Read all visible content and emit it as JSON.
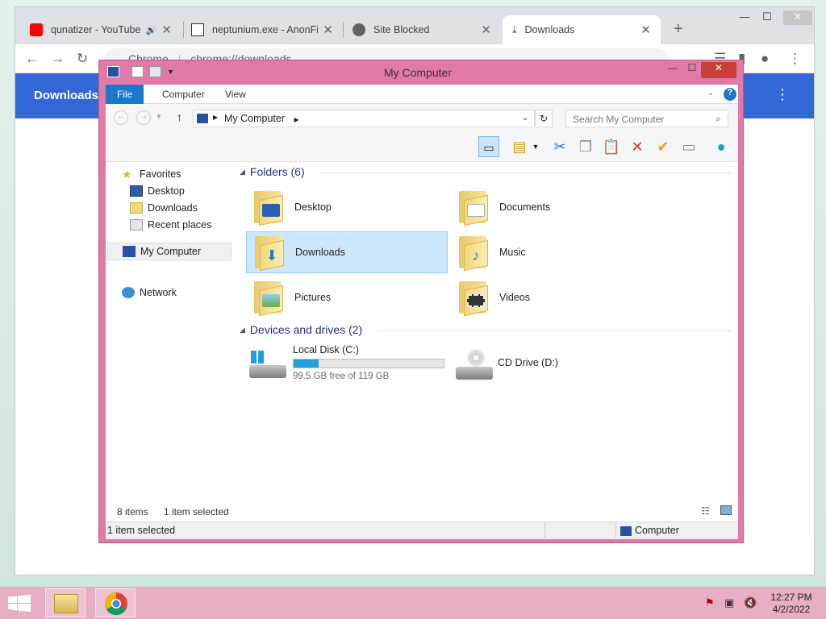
{
  "browser": {
    "tabs": [
      {
        "title": "qunatizer - YouTube",
        "favicon": "youtube-icon",
        "audio": true
      },
      {
        "title": "neptunium.exe - AnonFile",
        "favicon": "anonfiles-icon"
      },
      {
        "title": "Site Blocked",
        "favicon": "globe-icon"
      },
      {
        "title": "Downloads",
        "favicon": "download-icon",
        "active": true
      }
    ],
    "new_tab": "+",
    "omnibox_host": "Chrome",
    "omnibox_url": "chrome://downloads",
    "page_header": "Downloads",
    "colors": {
      "header": "#3367d6",
      "tabstrip": "#dee1e6"
    }
  },
  "explorer": {
    "title": "My Computer",
    "ribbon_tabs": [
      "File",
      "Computer",
      "View"
    ],
    "address": "My Computer",
    "search_placeholder": "Search My Computer",
    "nav": {
      "favorites_label": "Favorites",
      "favorites": [
        "Desktop",
        "Downloads",
        "Recent places"
      ],
      "my_computer": "My Computer",
      "network": "Network"
    },
    "folders_header": "Folders (6)",
    "folders": [
      {
        "name": "Desktop",
        "icon": "desktop-folder-icon"
      },
      {
        "name": "Documents",
        "icon": "documents-folder-icon"
      },
      {
        "name": "Downloads",
        "icon": "downloads-folder-icon",
        "selected": true
      },
      {
        "name": "Music",
        "icon": "music-folder-icon"
      },
      {
        "name": "Pictures",
        "icon": "pictures-folder-icon"
      },
      {
        "name": "Videos",
        "icon": "videos-folder-icon"
      }
    ],
    "devices_header": "Devices and drives (2)",
    "drives": [
      {
        "name": "Local Disk (C:)",
        "free_text": "99.5 GB free of 119 GB",
        "used_fraction": 0.164
      },
      {
        "name": "CD Drive (D:)"
      }
    ],
    "status_items": "8 items",
    "status_selected": "1 item selected",
    "status_bar_left": "1 item selected",
    "status_bar_right": "Computer",
    "colors": {
      "frame": "#e27aa8",
      "ribbon_file": "#1979ca",
      "selection": "#cce8ff"
    }
  },
  "taskbar": {
    "time": "12:27 PM",
    "date": "4/2/2022",
    "color": "#e7aec6"
  }
}
